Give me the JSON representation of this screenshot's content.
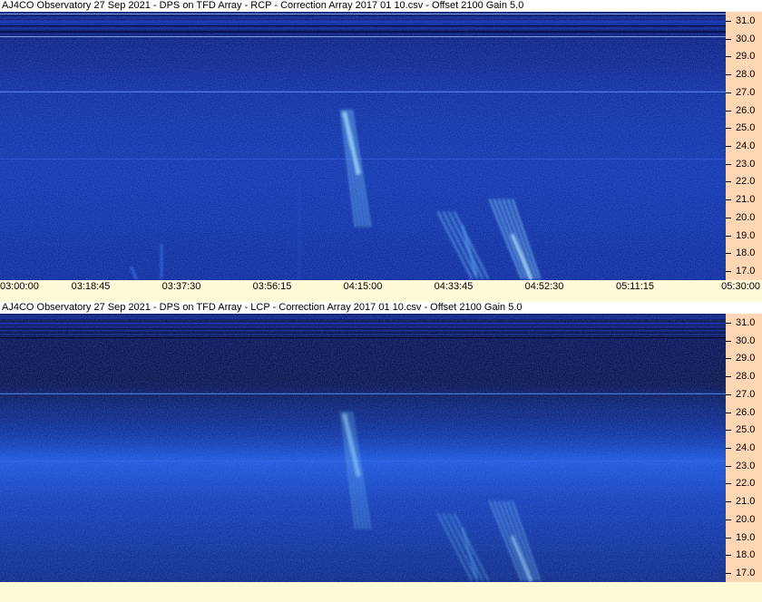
{
  "panels": [
    {
      "title": "AJ4CO Observatory 27 Sep 2021  -  DPS on TFD Array  -  RCP  -  Correction Array 2017 01 10.csv  -  Offset 2100  Gain 5.0",
      "polarization": "RCP"
    },
    {
      "title": "AJ4CO Observatory 27 Sep 2021  -  DPS on TFD Array  -  LCP  -  Correction Array 2017 01 10.csv  -  Offset 2100  Gain 5.0",
      "polarization": "LCP"
    }
  ],
  "time_ticks": [
    "03:00:00",
    "03:18:45",
    "03:37:30",
    "03:56:15",
    "04:15:00",
    "04:33:45",
    "04:52:30",
    "05:11:15",
    "05:30:00"
  ],
  "freq_ticks": [
    "31.0",
    "30.0",
    "29.0",
    "28.0",
    "27.0",
    "26.0",
    "25.0",
    "24.0",
    "23.0",
    "22.0",
    "21.0",
    "20.0",
    "19.0",
    "18.0",
    "17.0"
  ],
  "colors": {
    "background": "#0a1e7a",
    "emission": "#6fc8ff",
    "axis_bg": "#ffd7b4",
    "time_bar": "#fffbd8"
  },
  "chart_data": [
    {
      "type": "heatmap",
      "title": "AJ4CO Observatory 27 Sep 2021  -  DPS on TFD Array  -  RCP  -  Correction Array 2017 01 10.csv  -  Offset 2100  Gain 5.0",
      "x": [
        "03:00:00",
        "03:18:45",
        "03:37:30",
        "03:56:15",
        "04:15:00",
        "04:33:45",
        "04:52:30",
        "05:11:15",
        "05:30:00"
      ],
      "ylim": [
        16.5,
        31.5
      ],
      "y_ticks": [
        17,
        18,
        19,
        20,
        21,
        22,
        23,
        24,
        25,
        26,
        27,
        28,
        29,
        30,
        31
      ]
    },
    {
      "type": "heatmap",
      "title": "AJ4CO Observatory 27 Sep 2021  -  DPS on TFD Array  -  LCP  -  Correction Array 2017 01 10.csv  -  Offset 2100  Gain 5.0",
      "x": [
        "03:00:00",
        "03:18:45",
        "03:37:30",
        "03:56:15",
        "04:15:00",
        "04:33:45",
        "04:52:30",
        "05:11:15",
        "05:30:00"
      ],
      "ylim": [
        16.5,
        31.5
      ],
      "y_ticks": [
        17,
        18,
        19,
        20,
        21,
        22,
        23,
        24,
        25,
        26,
        27,
        28,
        29,
        30,
        31
      ]
    }
  ]
}
